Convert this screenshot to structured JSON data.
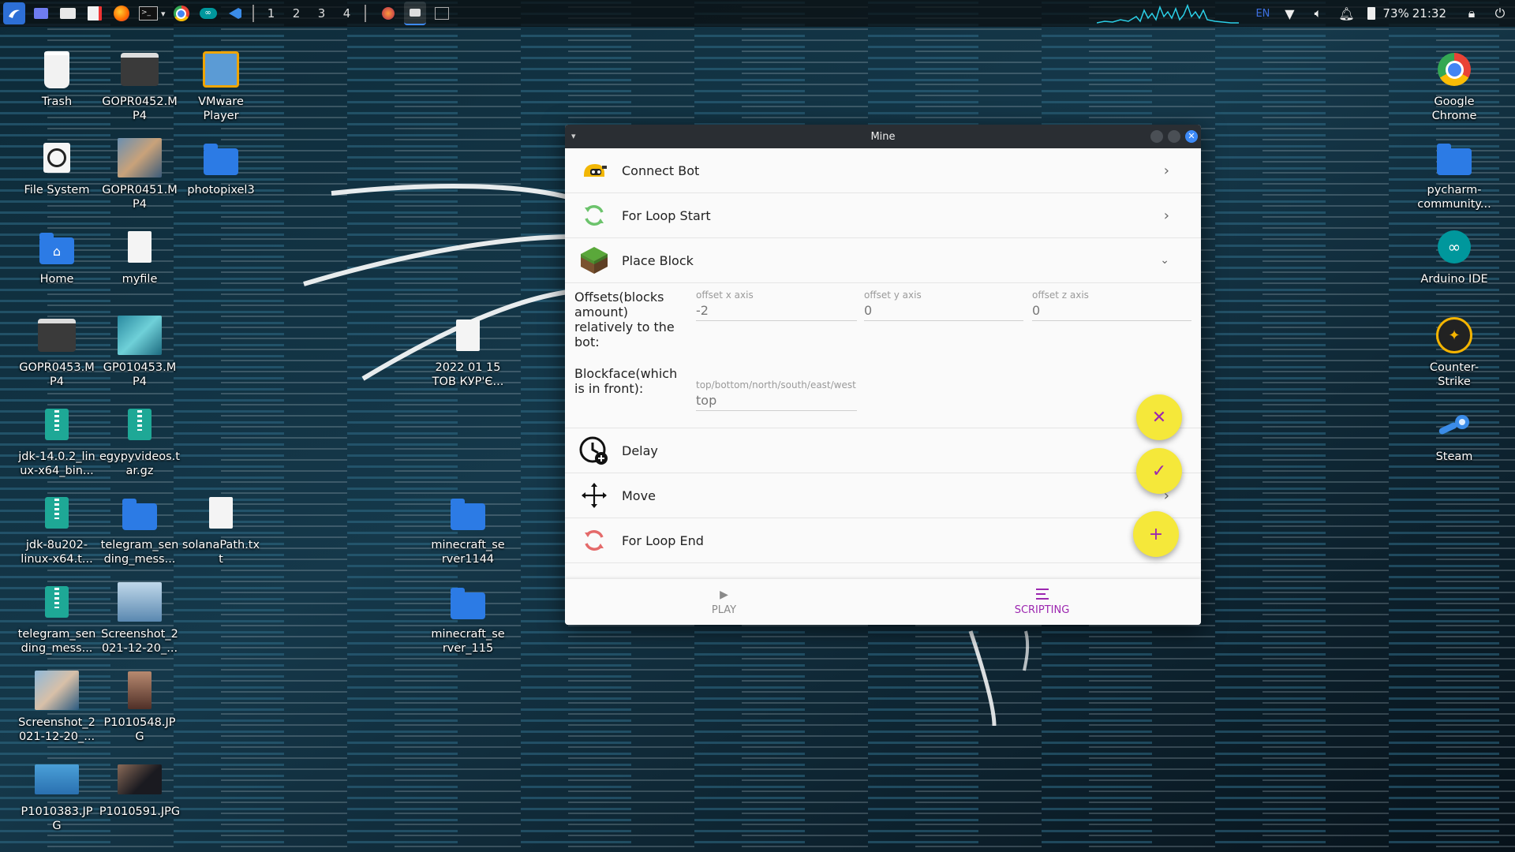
{
  "taskbar": {
    "workspaces": [
      "1",
      "2",
      "3",
      "4"
    ],
    "language": "EN",
    "battery": "73%",
    "clock": "21:32"
  },
  "desktop": {
    "icons": [
      {
        "label": "Trash",
        "icon": "trash-icon"
      },
      {
        "label": "GOPR0452.M P4",
        "icon": "video-icon"
      },
      {
        "label": "VMware Player",
        "icon": "vmware-icon"
      },
      {
        "label": "File System",
        "icon": "filesystem-icon"
      },
      {
        "label": "GOPR0451.M P4",
        "icon": "video-thumbnail"
      },
      {
        "label": "photopixel3",
        "icon": "folder-icon"
      },
      {
        "label": "Home",
        "icon": "home-folder-icon"
      },
      {
        "label": "myfile",
        "icon": "document-icon"
      },
      {
        "label": "GOPR0453.M P4",
        "icon": "video-icon"
      },
      {
        "label": "GP010453.M P4",
        "icon": "video-thumbnail"
      },
      {
        "label": "2022 01 15 ТОВ КУР'Є...",
        "icon": "document-icon"
      },
      {
        "label": "jdk-14.0.2_lin ux-x64_bin...",
        "icon": "archive-icon"
      },
      {
        "label": "egypyvideos.t ar.gz",
        "icon": "archive-icon"
      },
      {
        "label": "jdk-8u202- linux-x64.t...",
        "icon": "archive-icon"
      },
      {
        "label": "telegram_sen ding_mess...",
        "icon": "folder-icon"
      },
      {
        "label": "solanaPath.tx t",
        "icon": "text-file-icon"
      },
      {
        "label": "minecraft_se rver1144",
        "icon": "folder-icon"
      },
      {
        "label": "telegram_sen ding_mess...",
        "icon": "archive-icon"
      },
      {
        "label": "Screenshot_2 021-12-20_...",
        "icon": "image-thumbnail"
      },
      {
        "label": "minecraft_se rver_115",
        "icon": "folder-icon"
      },
      {
        "label": "Screenshot_2 021-12-20_...",
        "icon": "image-thumbnail"
      },
      {
        "label": "P1010548.JP G",
        "icon": "image-thumbnail"
      },
      {
        "label": "P1010383.JP G",
        "icon": "image-thumbnail"
      },
      {
        "label": "P1010591.JPG",
        "icon": "image-thumbnail"
      },
      {
        "label": "Google Chrome",
        "icon": "chrome-icon"
      },
      {
        "label": "pycharm- community...",
        "icon": "folder-icon"
      },
      {
        "label": "Arduino IDE",
        "icon": "arduino-icon"
      },
      {
        "label": "Counter- Strike",
        "icon": "counter-strike-icon"
      },
      {
        "label": "Steam",
        "icon": "steam-icon"
      }
    ]
  },
  "window": {
    "title": "Mine",
    "rows": {
      "connect_bot": "Connect Bot",
      "for_loop_start": "For Loop Start",
      "place_block": "Place Block",
      "delay": "Delay",
      "move": "Move",
      "for_loop_end": "For Loop End"
    },
    "params": {
      "offsets_label": "Offsets(blocks amount) relatively to the bot:",
      "offset_x": {
        "caption": "offset x axis",
        "value": "-2"
      },
      "offset_y": {
        "caption": "offset y axis",
        "value": "0"
      },
      "offset_z": {
        "caption": "offset z axis",
        "value": "0"
      },
      "blockface_label": "Blockface(which is in front):",
      "blockface": {
        "caption": "top/bottom/north/south/east/west",
        "value": "top"
      }
    },
    "fab_colors": {
      "background": "#f5e83a",
      "icon": "#9c27b0"
    },
    "nav": {
      "play": "PLAY",
      "scripting": "SCRIPTING",
      "active_color": "#9c27b0"
    }
  }
}
